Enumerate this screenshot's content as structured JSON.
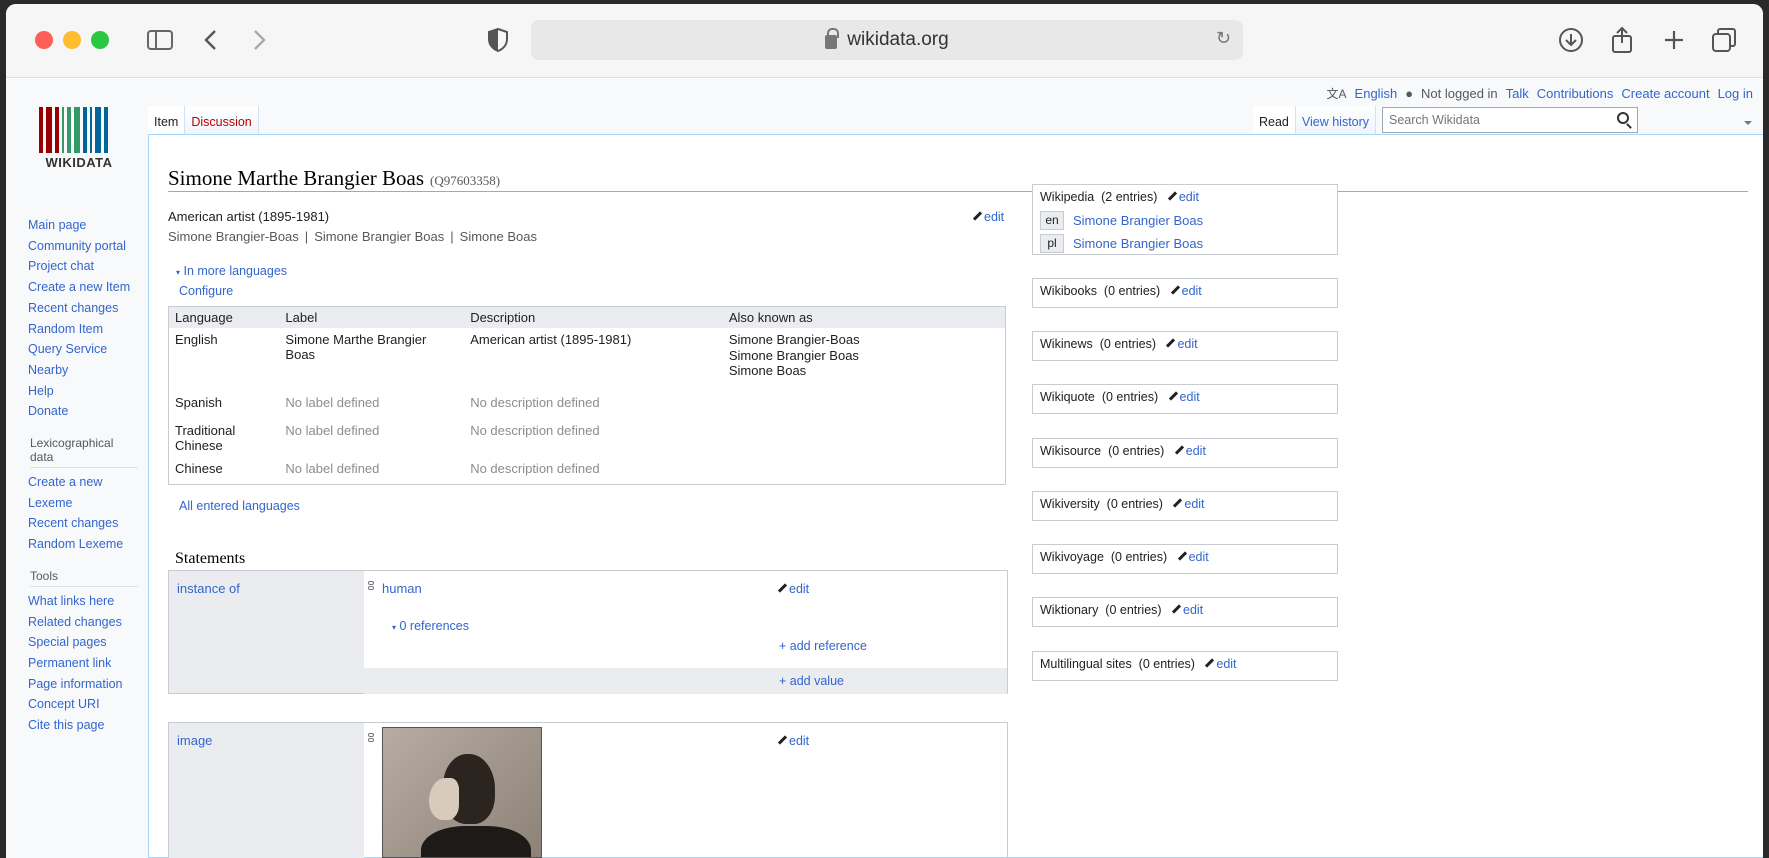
{
  "browser": {
    "url": "wikidata.org"
  },
  "personal": {
    "language": "English",
    "not_logged_in": "Not logged in",
    "talk": "Talk",
    "contributions": "Contributions",
    "create_account": "Create account",
    "log_in": "Log in"
  },
  "logo": {
    "text": "WIKIDATA"
  },
  "tabs": {
    "item": "Item",
    "discussion": "Discussion",
    "read": "Read",
    "view_history": "View history"
  },
  "search": {
    "placeholder": "Search Wikidata"
  },
  "nav": {
    "main": [
      "Main page",
      "Community portal",
      "Project chat",
      "Create a new Item",
      "Recent changes",
      "Random Item",
      "Query Service",
      "Nearby",
      "Help",
      "Donate"
    ],
    "lexico_heading": "Lexicographical data",
    "lexico": [
      "Create a new Lexeme",
      "Recent changes",
      "Random Lexeme"
    ],
    "tools_heading": "Tools",
    "tools": [
      "What links here",
      "Related changes",
      "Special pages",
      "Permanent link",
      "Page information",
      "Concept URI",
      "Cite this page"
    ]
  },
  "item": {
    "label": "Simone Marthe Brangier Boas",
    "qid": "(Q97603358)",
    "description": "American artist (1895-1981)",
    "aliases": [
      "Simone Brangier-Boas",
      "Simone Brangier Boas",
      "Simone Boas"
    ],
    "edit": "edit",
    "in_more_languages": "In more languages",
    "configure": "Configure",
    "all_languages": "All entered languages"
  },
  "lang_table": {
    "headers": [
      "Language",
      "Label",
      "Description",
      "Also known as"
    ],
    "rows": [
      {
        "language": "English",
        "label": "Simone Marthe Brangier Boas",
        "description": "American artist (1895-1981)",
        "aliases": [
          "Simone Brangier-Boas",
          "Simone Brangier Boas",
          "Simone Boas"
        ]
      },
      {
        "language": "Spanish",
        "label": "No label defined",
        "description": "No description defined"
      },
      {
        "language": "Traditional Chinese",
        "label": "No label defined",
        "description": "No description defined"
      },
      {
        "language": "Chinese",
        "label": "No label defined",
        "description": "No description defined"
      }
    ]
  },
  "statements": {
    "heading": "Statements",
    "instance_of": {
      "property": "instance of",
      "value": "human",
      "references": "0 references",
      "add_reference": "+ add reference",
      "add_value": "+ add value"
    },
    "image": {
      "property": "image"
    }
  },
  "sitelinks": [
    {
      "name": "Wikipedia",
      "count": "(2 entries)",
      "links": [
        {
          "code": "en",
          "title": "Simone Brangier Boas"
        },
        {
          "code": "pl",
          "title": "Simone Brangier Boas"
        }
      ]
    },
    {
      "name": "Wikibooks",
      "count": "(0 entries)"
    },
    {
      "name": "Wikinews",
      "count": "(0 entries)"
    },
    {
      "name": "Wikiquote",
      "count": "(0 entries)"
    },
    {
      "name": "Wikisource",
      "count": "(0 entries)"
    },
    {
      "name": "Wikiversity",
      "count": "(0 entries)"
    },
    {
      "name": "Wikivoyage",
      "count": "(0 entries)"
    },
    {
      "name": "Wiktionary",
      "count": "(0 entries)"
    },
    {
      "name": "Multilingual sites",
      "count": "(0 entries)"
    }
  ],
  "colors": {
    "link": "#3366cc",
    "discussion_red": "#ba0000",
    "logo_red": "#990000",
    "logo_green": "#339966",
    "logo_blue": "#006699"
  }
}
